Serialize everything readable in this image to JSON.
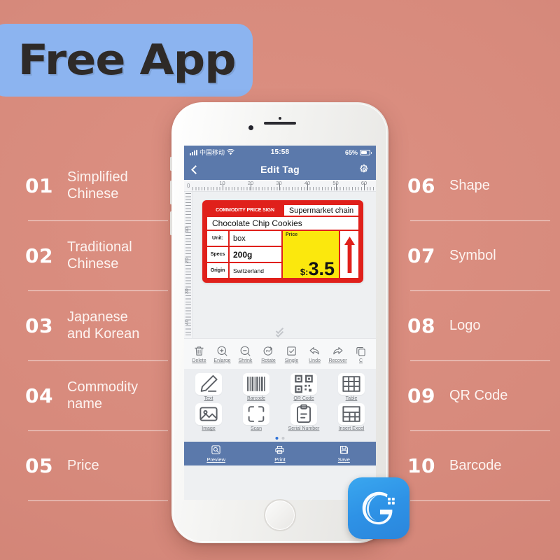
{
  "banner": {
    "text": "Free App"
  },
  "features_left": [
    {
      "num": "01",
      "label": "Simplified\nChinese"
    },
    {
      "num": "02",
      "label": "Traditional\nChinese"
    },
    {
      "num": "03",
      "label": "Japanese\nand Korean"
    },
    {
      "num": "04",
      "label": "Commodity\nname"
    },
    {
      "num": "05",
      "label": "Price"
    }
  ],
  "features_right": [
    {
      "num": "06",
      "label": "Shape"
    },
    {
      "num": "07",
      "label": "Symbol"
    },
    {
      "num": "08",
      "label": "Logo"
    },
    {
      "num": "09",
      "label": "QR Code"
    },
    {
      "num": "10",
      "label": "Barcode"
    }
  ],
  "phone": {
    "status_bar": {
      "carrier": "中国移动",
      "time": "15:58",
      "battery": "65%"
    },
    "nav_bar": {
      "title": "Edit Tag",
      "back_icon": "chevron-left-icon",
      "settings_icon": "gear-icon"
    },
    "ruler": {
      "origin": "0",
      "marks": [
        "10",
        "20",
        "30",
        "40",
        "50",
        "60"
      ],
      "v_marks": [
        "10",
        "20",
        "30",
        "40"
      ]
    },
    "label_card": {
      "sign_title": "COMMODITY PRICE SIGN",
      "chain": "Supermarket chain",
      "product": "Chocolate Chip Cookies",
      "fields": [
        {
          "key": "Unit:",
          "value": "box"
        },
        {
          "key": "Specs",
          "value": "200g"
        },
        {
          "key": "Origin",
          "value": "Switzerland"
        }
      ],
      "price_label": "Price",
      "currency": "$:",
      "price": "3.5",
      "arrow_icon": "up-arrow-icon"
    },
    "collapse_icon": "double-chevron-down-icon",
    "toolbar": [
      {
        "label": "Delete",
        "icon": "trash-icon"
      },
      {
        "label": "Enlarge",
        "icon": "zoom-in-icon"
      },
      {
        "label": "Shrink",
        "icon": "zoom-out-icon"
      },
      {
        "label": "Rotate",
        "icon": "rotate-icon"
      },
      {
        "label": "Single",
        "icon": "checkbox-icon"
      },
      {
        "label": "Undo",
        "icon": "undo-arrow-icon"
      },
      {
        "label": "Recover",
        "icon": "redo-arrow-icon"
      },
      {
        "label": "C",
        "icon": "copy-icon"
      }
    ],
    "functions_row1": [
      {
        "label": "Text",
        "icon": "pencil-icon"
      },
      {
        "label": "Barcode",
        "icon": "barcode-icon"
      },
      {
        "label": "QR Code",
        "icon": "qr-code-icon"
      },
      {
        "label": "Table",
        "icon": "table-icon"
      }
    ],
    "functions_row2": [
      {
        "label": "Image",
        "icon": "image-icon"
      },
      {
        "label": "Scan",
        "icon": "scan-frame-icon"
      },
      {
        "label": "Serial Number",
        "icon": "clipboard-icon"
      },
      {
        "label": "Insert Excel",
        "icon": "spreadsheet-icon"
      }
    ],
    "page_dots": {
      "count": 2,
      "active": 0
    },
    "bottom_bar": [
      {
        "label": "Preview",
        "icon": "preview-icon"
      },
      {
        "label": "Print",
        "icon": "printer-icon"
      },
      {
        "label": "Save",
        "icon": "save-disk-icon"
      }
    ]
  },
  "app_logo": {
    "icon": "app-logo-g-icon"
  },
  "colors": {
    "background": "#d98c7e",
    "banner_blue": "#8cb4f0",
    "ui_blue": "#5b79ab",
    "label_red": "#e0201b",
    "price_yellow": "#fbe80d",
    "logo_blue": "#2e92e6"
  }
}
